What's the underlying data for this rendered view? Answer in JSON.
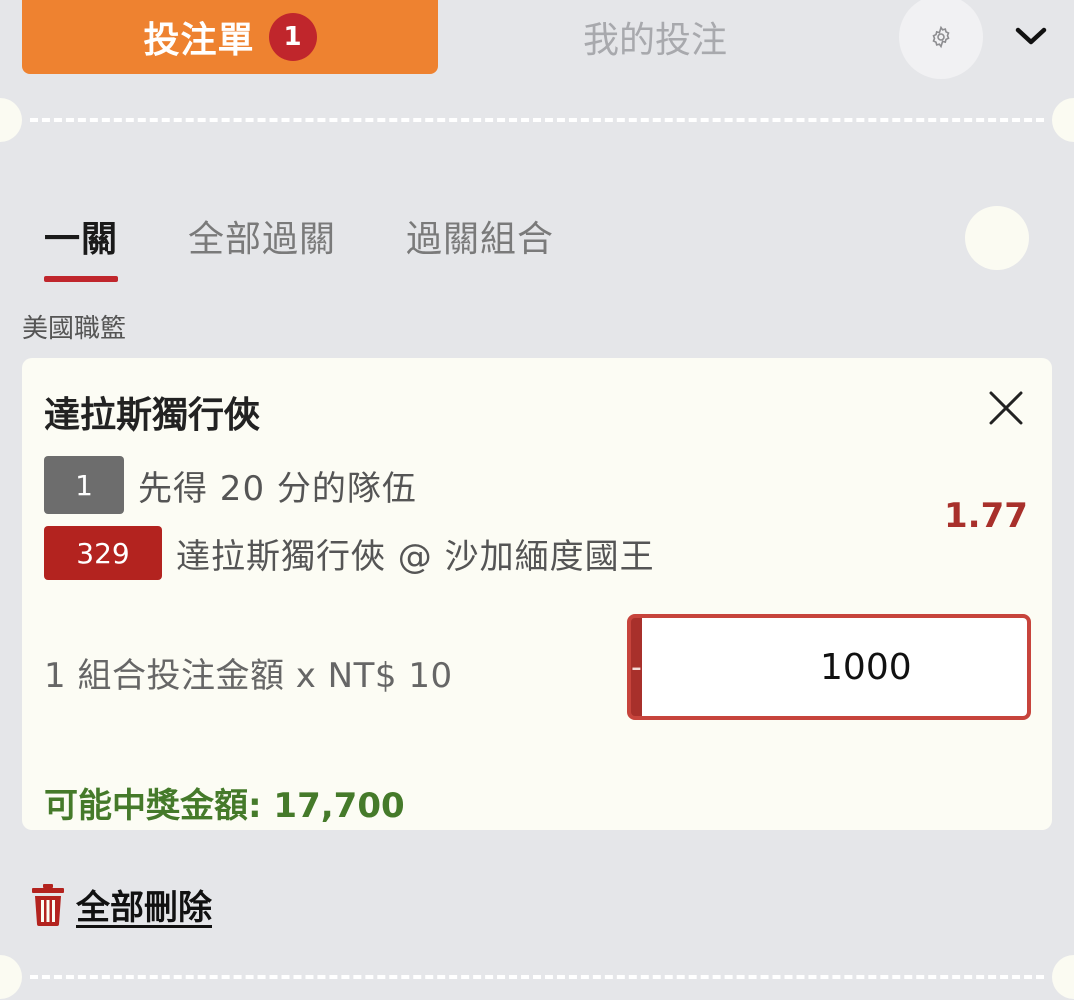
{
  "header": {
    "betslip_label": "投注單",
    "betslip_count": "1",
    "mybets_label": "我的投注"
  },
  "subtabs": [
    {
      "label": "一關",
      "active": true
    },
    {
      "label": "全部過關",
      "active": false
    },
    {
      "label": "過關組合",
      "active": false
    }
  ],
  "league": "美國職籃",
  "bet": {
    "team": "達拉斯獨行俠",
    "market_tag": "1",
    "market": "先得 20 分的隊伍",
    "event_tag": "329",
    "event": "達拉斯獨行俠 @ 沙加緬度國王",
    "odds": "1.77",
    "stake_label": "1 組合投注金額 x NT$ 10",
    "minus_label": "-",
    "plus_label": "+",
    "stake_value": "1000",
    "payout": "可能中獎金額: 17,700"
  },
  "footer": {
    "clear_all_label": "全部刪除"
  },
  "colors": {
    "accent_orange": "#ee8230",
    "brand_red": "#b3231f",
    "payout_green": "#457a2a",
    "background": "#e5e6e9"
  }
}
